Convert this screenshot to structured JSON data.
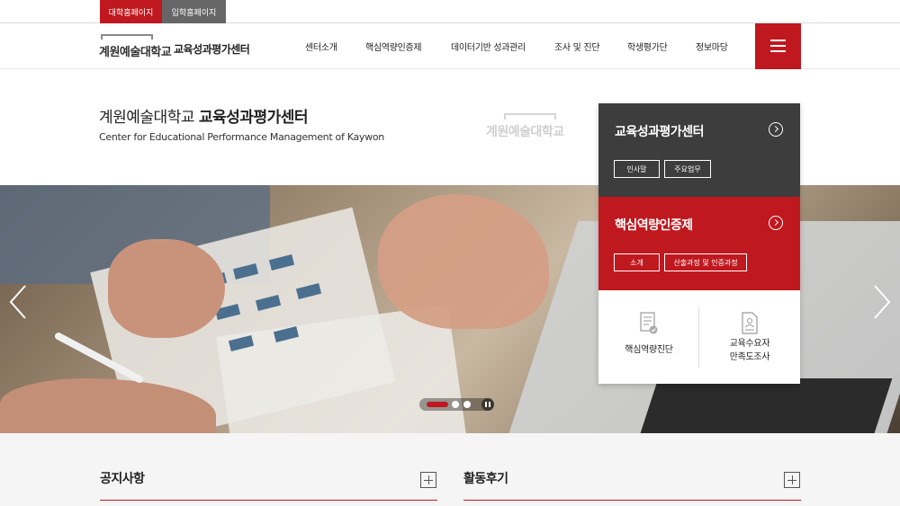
{
  "top_tabs": [
    "대학홈페이지",
    "입학홈페이지"
  ],
  "logo": {
    "name": "계원예술대학교",
    "subtitle": "교육성과평가센터"
  },
  "nav": [
    "센터소개",
    "핵심역량인증제",
    "데이터기반 성과관리",
    "조사 및 진단",
    "학생평가단",
    "정보마당"
  ],
  "intro": {
    "title_prefix": "계원예술대학교",
    "title_bold": "교육성과평가센터",
    "english": "Center for Educational Performance Management of Kaywon",
    "watermark": "계원예술대학교"
  },
  "panel": {
    "section1": {
      "title": "교육성과평가센터",
      "buttons": [
        "인사말",
        "주요업무"
      ]
    },
    "section2": {
      "title": "핵심역량인증제",
      "buttons": [
        "소개",
        "산출과정 및 인증과정"
      ]
    },
    "quick": [
      {
        "label": "핵심역량진단",
        "icon": "document-check-icon"
      },
      {
        "label_line1": "교육수요자",
        "label_line2": "만족도조사",
        "icon": "survey-document-icon"
      }
    ]
  },
  "slider": {
    "slides": 3,
    "active": 1
  },
  "bottom": {
    "notice_title": "공지사항",
    "review_title": "활동후기"
  },
  "colors": {
    "brand_red": "#c0181f",
    "dark_panel": "#3d3d3d"
  }
}
